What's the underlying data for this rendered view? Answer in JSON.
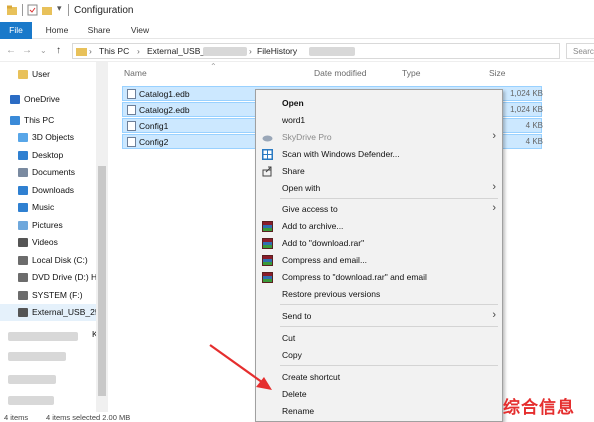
{
  "window": {
    "title": "Configuration"
  },
  "ribbon": {
    "tabs": [
      "File",
      "Home",
      "Share",
      "View"
    ]
  },
  "address": {
    "crumbs": [
      "This PC",
      "External_USB_",
      "FileHistory"
    ],
    "search_placeholder": "Searc"
  },
  "nav": {
    "items": [
      {
        "label": "User",
        "icon": "folder-icon",
        "color": "#e8c15a"
      },
      {
        "label": "OneDrive",
        "icon": "cloud-icon",
        "color": "#2b6cc4"
      },
      {
        "label": "This PC",
        "icon": "computer-icon",
        "color": "#3a8ad8"
      },
      {
        "label": "3D Objects",
        "icon": "cube-icon",
        "color": "#58a6e8"
      },
      {
        "label": "Desktop",
        "icon": "desktop-icon",
        "color": "#2f80d1"
      },
      {
        "label": "Documents",
        "icon": "documents-icon",
        "color": "#7a8aa0"
      },
      {
        "label": "Downloads",
        "icon": "download-icon",
        "color": "#2f80d1"
      },
      {
        "label": "Music",
        "icon": "music-icon",
        "color": "#2f80d1"
      },
      {
        "label": "Pictures",
        "icon": "pictures-icon",
        "color": "#6fa8dc"
      },
      {
        "label": "Videos",
        "icon": "video-icon",
        "color": "#555555"
      },
      {
        "label": "Local Disk (C:)",
        "icon": "drive-icon",
        "color": "#6c6c6c"
      },
      {
        "label": "DVD Drive (D:) H",
        "icon": "dvd-icon",
        "color": "#6c6c6c"
      },
      {
        "label": "SYSTEM (F:)",
        "icon": "drive-icon",
        "color": "#6c6c6c"
      },
      {
        "label": "External_USB_25(",
        "icon": "usb-drive-icon",
        "color": "#555555"
      },
      {
        "label": "K",
        "icon": "",
        "color": ""
      }
    ]
  },
  "list": {
    "columns": [
      "Name",
      "Date modified",
      "Type",
      "Size"
    ],
    "files": [
      {
        "name": "Catalog1.edb",
        "size": "1,024 KB"
      },
      {
        "name": "Catalog2.edb",
        "size": "1,024 KB"
      },
      {
        "name": "Config1",
        "size": "4 KB"
      },
      {
        "name": "Config2",
        "size": "4 KB"
      }
    ]
  },
  "status": {
    "count": "4 items",
    "selected": "4 items selected  2.00 MB"
  },
  "context_menu": {
    "items": [
      {
        "label": "Open",
        "bold": true,
        "icon": ""
      },
      {
        "label": "word1",
        "icon": ""
      },
      {
        "label": "SkyDrive Pro",
        "dim": true,
        "icon": "skydrive-icon",
        "submenu": true
      },
      {
        "label": "Scan with Windows Defender...",
        "icon": "defender-icon"
      },
      {
        "label": "Share",
        "icon": "share-icon"
      },
      {
        "label": "Open with",
        "icon": "",
        "submenu": true
      },
      {
        "label": "Give access to",
        "icon": "",
        "submenu": true
      },
      {
        "label": "Add to archive...",
        "icon": "winrar-icon"
      },
      {
        "label": "Add to \"download.rar\"",
        "icon": "winrar-icon"
      },
      {
        "label": "Compress and email...",
        "icon": "winrar-icon"
      },
      {
        "label": "Compress to \"download.rar\" and email",
        "icon": "winrar-icon"
      },
      {
        "label": "Restore previous versions",
        "icon": ""
      },
      {
        "label": "Send to",
        "icon": "",
        "submenu": true
      },
      {
        "label": "Cut",
        "icon": ""
      },
      {
        "label": "Copy",
        "icon": ""
      },
      {
        "label": "Create shortcut",
        "icon": ""
      },
      {
        "label": "Delete",
        "icon": ""
      },
      {
        "label": "Rename",
        "icon": ""
      }
    ]
  },
  "watermark": {
    "text": "综合信息",
    "color": "#e52e2e"
  },
  "colors": {
    "accent": "#1979ca",
    "selection": "#cce8ff",
    "annotation_arrow": "#e52e2e"
  }
}
